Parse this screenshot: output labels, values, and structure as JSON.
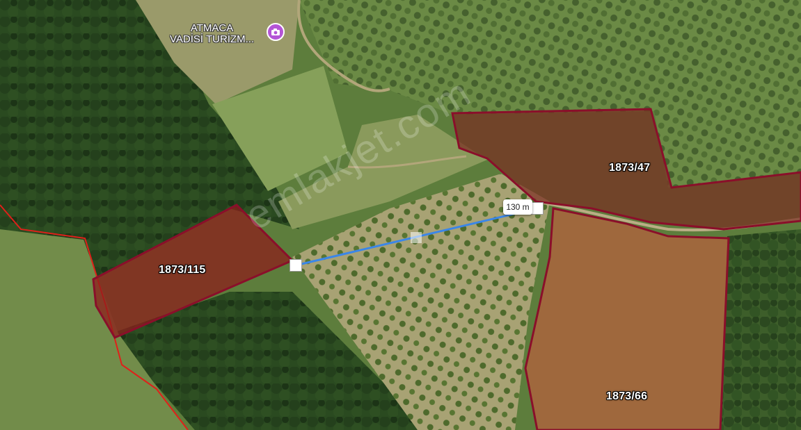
{
  "map": {
    "poi": {
      "line1": "ATMACA",
      "line2": "VADİSİ TURİZM...",
      "icon": "camera-icon",
      "pin_color": "#b455d6"
    },
    "parcels": [
      {
        "id": "1873/115",
        "fill": "#8e1a1a"
      },
      {
        "id": "1873/47",
        "fill": "#7a2a20"
      },
      {
        "id": "1873/66",
        "fill": "#b8603f"
      }
    ],
    "parcel_outline_color": "#8a0f2a",
    "boundary_line_color": "#e0201a",
    "measurement": {
      "distance_label": "130 m",
      "line_color": "#3a86e8"
    },
    "watermark": "emlakjet.com"
  }
}
